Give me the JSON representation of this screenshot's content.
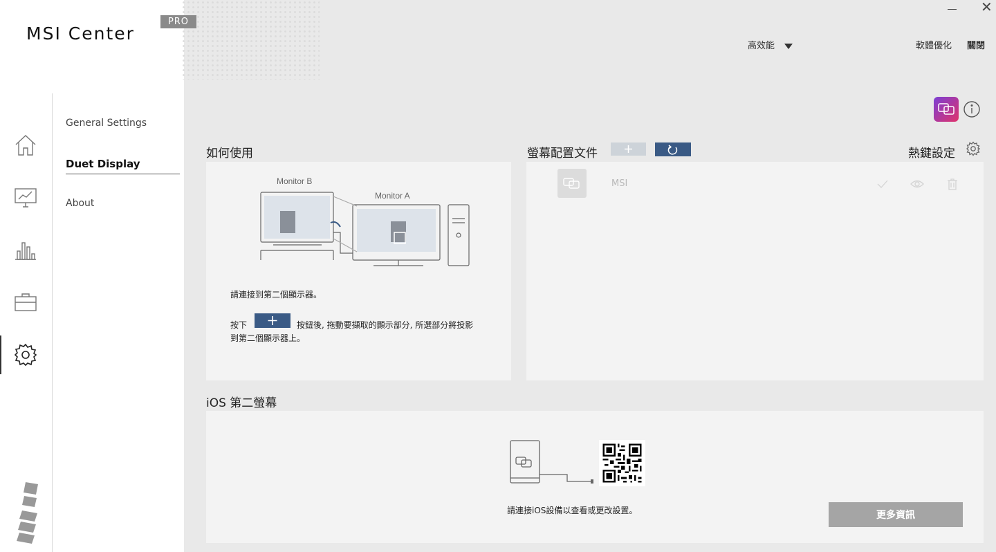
{
  "app": {
    "title": "MSI Center",
    "badge": "PRO"
  },
  "titlebar": {
    "minimize_icon": "minimize-icon",
    "close_glyph": "✕"
  },
  "header": {
    "mode_value": "高效能",
    "links": [
      "軟體優化",
      "關閉"
    ]
  },
  "sidebar": {
    "icons": [
      "home-icon",
      "monitor-chart-icon",
      "bar-chart-icon",
      "toolbox-icon",
      "gear-icon"
    ],
    "active_index": 4
  },
  "submenu": {
    "items": [
      "General Settings",
      "Duet Display",
      "About"
    ],
    "active": "Duet Display"
  },
  "how_to": {
    "title": "如何使用",
    "monitor_b": "Monitor B",
    "monitor_a": "Monitor A",
    "step1": "請連接到第二個顯示器。",
    "step2_prefix": "按下",
    "step2_suffix": "按鈕後, 拖動要擷取的顯示部分, 所選部分將投影",
    "step2_line2": "到第二個顯示器上。"
  },
  "profiles": {
    "title": "螢幕配置文件",
    "hotkey_label": "熱鍵設定",
    "items": [
      {
        "name": "MSI"
      }
    ]
  },
  "ios": {
    "title": "iOS 第二螢幕",
    "instruction": "請連接iOS設備以查看或更改設置。",
    "more_button": "更多資訊"
  },
  "colors": {
    "accent": "#3a5a85",
    "disabled_button": "#a5a5a5",
    "panel_bg": "#f3f3f3",
    "page_bg": "#e9e9e9"
  }
}
